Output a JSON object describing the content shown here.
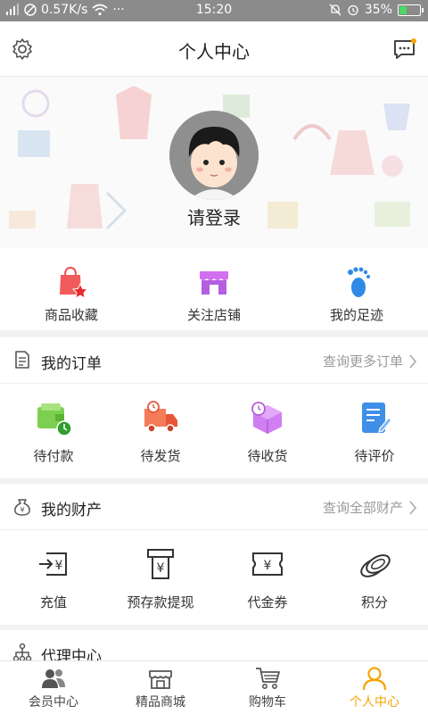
{
  "status_bar": {
    "speed": "0.57K/s",
    "dots": "···",
    "time": "15:20",
    "battery": "35%",
    "battery_level": 0.35
  },
  "header": {
    "title": "个人中心",
    "settings_icon": "gear-icon",
    "message_icon": "message-icon"
  },
  "profile": {
    "login_text": "请登录"
  },
  "quick_links": [
    {
      "label": "商品收藏",
      "icon": "bag-star-icon"
    },
    {
      "label": "关注店铺",
      "icon": "store-icon"
    },
    {
      "label": "我的足迹",
      "icon": "footprint-icon"
    }
  ],
  "orders": {
    "title": "我的订单",
    "more": "查询更多订单",
    "items": [
      {
        "label": "待付款",
        "icon": "wallet-icon"
      },
      {
        "label": "待发货",
        "icon": "truck-icon"
      },
      {
        "label": "待收货",
        "icon": "box-icon"
      },
      {
        "label": "待评价",
        "icon": "review-icon"
      }
    ]
  },
  "assets": {
    "title": "我的财产",
    "more": "查询全部财产",
    "items": [
      {
        "label": "充值",
        "icon": "recharge-icon"
      },
      {
        "label": "预存款提现",
        "icon": "withdraw-icon"
      },
      {
        "label": "代金券",
        "icon": "coupon-icon"
      },
      {
        "label": "积分",
        "icon": "points-icon"
      }
    ]
  },
  "agent": {
    "title": "代理中心"
  },
  "tabbar": {
    "active_color": "#f5a500",
    "items": [
      {
        "label": "会员中心",
        "icon": "members-icon"
      },
      {
        "label": "精品商城",
        "icon": "shop-icon"
      },
      {
        "label": "购物车",
        "icon": "cart-icon"
      },
      {
        "label": "个人中心",
        "icon": "person-icon"
      }
    ]
  }
}
